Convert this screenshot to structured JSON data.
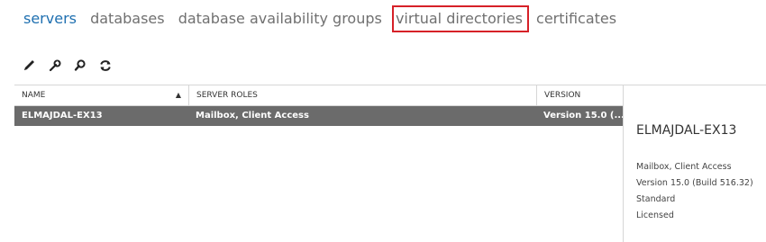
{
  "nav": {
    "tabs": [
      {
        "label": "servers"
      },
      {
        "label": "databases"
      },
      {
        "label": "database availability groups"
      },
      {
        "label": "virtual directories"
      },
      {
        "label": "certificates"
      }
    ]
  },
  "toolbar": {
    "icons": [
      "pencil-icon",
      "wrench-icon",
      "search-icon",
      "refresh-icon"
    ]
  },
  "table": {
    "columns": [
      "NAME",
      "SERVER ROLES",
      "VERSION"
    ],
    "rows": [
      {
        "name": "ELMAJDAL-EX13",
        "roles": "Mailbox, Client Access",
        "version": "Version 15.0 (..."
      }
    ]
  },
  "details": {
    "title": "ELMAJDAL-EX13",
    "lines": [
      "Mailbox, Client Access",
      "Version 15.0 (Build 516.32)",
      "Standard",
      "Licensed"
    ]
  },
  "colors": {
    "active_tab": "#1e6fb0",
    "highlight_box": "#d62128",
    "selected_row": "#6b6b6b"
  }
}
